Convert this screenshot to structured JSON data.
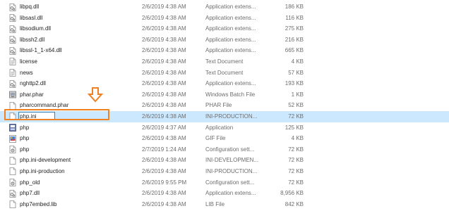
{
  "files": [
    {
      "name": "libpq.dll",
      "date": "2/6/2019 4:38 AM",
      "type": "Application extens...",
      "size": "186 KB",
      "icon": "dll-file-icon"
    },
    {
      "name": "libsasl.dll",
      "date": "2/6/2019 4:38 AM",
      "type": "Application extens...",
      "size": "116 KB",
      "icon": "dll-file-icon"
    },
    {
      "name": "libsodium.dll",
      "date": "2/6/2019 4:38 AM",
      "type": "Application extens...",
      "size": "275 KB",
      "icon": "dll-file-icon"
    },
    {
      "name": "libssh2.dll",
      "date": "2/6/2019 4:38 AM",
      "type": "Application extens...",
      "size": "216 KB",
      "icon": "dll-file-icon"
    },
    {
      "name": "libssl-1_1-x64.dll",
      "date": "2/6/2019 4:38 AM",
      "type": "Application extens...",
      "size": "665 KB",
      "icon": "dll-file-icon"
    },
    {
      "name": "license",
      "date": "2/6/2019 4:38 AM",
      "type": "Text Document",
      "size": "4 KB",
      "icon": "text-file-icon"
    },
    {
      "name": "news",
      "date": "2/6/2019 4:38 AM",
      "type": "Text Document",
      "size": "57 KB",
      "icon": "text-file-icon"
    },
    {
      "name": "nghttp2.dll",
      "date": "2/6/2019 4:38 AM",
      "type": "Application extens...",
      "size": "193 KB",
      "icon": "dll-file-icon"
    },
    {
      "name": "phar.phar",
      "date": "2/6/2019 4:38 AM",
      "type": "Windows Batch File",
      "size": "1 KB",
      "icon": "batch-file-icon"
    },
    {
      "name": "pharcommand.phar",
      "date": "2/6/2019 4:38 AM",
      "type": "PHAR File",
      "size": "52 KB",
      "icon": "blank-file-icon"
    },
    {
      "name": "php.ini",
      "date": "2/6/2019 4:38 AM",
      "type": "INI-PRODUCTION...",
      "size": "72 KB",
      "icon": "blank-file-icon",
      "selected": true,
      "renaming": true
    },
    {
      "name": "php",
      "date": "2/6/2019 4:37 AM",
      "type": "Application",
      "size": "125 KB",
      "icon": "php-exe-icon"
    },
    {
      "name": "php",
      "date": "2/6/2019 4:38 AM",
      "type": "GIF File",
      "size": "4 KB",
      "icon": "image-file-icon"
    },
    {
      "name": "php",
      "date": "2/7/2019 1:24 AM",
      "type": "Configuration sett...",
      "size": "72 KB",
      "icon": "config-file-icon"
    },
    {
      "name": "php.ini-development",
      "date": "2/6/2019 4:38 AM",
      "type": "INI-DEVELOPMEN...",
      "size": "72 KB",
      "icon": "blank-file-icon"
    },
    {
      "name": "php.ini-production",
      "date": "2/6/2019 4:38 AM",
      "type": "INI-PRODUCTION...",
      "size": "72 KB",
      "icon": "blank-file-icon"
    },
    {
      "name": "php_old",
      "date": "2/6/2019 9:55 PM",
      "type": "Configuration sett...",
      "size": "72 KB",
      "icon": "config-file-icon"
    },
    {
      "name": "php7.dll",
      "date": "2/6/2019 4:38 AM",
      "type": "Application extens...",
      "size": "8,956 KB",
      "icon": "dll-file-icon"
    },
    {
      "name": "php7embed.lib",
      "date": "2/6/2019 4:38 AM",
      "type": "LIB File",
      "size": "842 KB",
      "icon": "blank-file-icon"
    }
  ],
  "annotation": {
    "arrow_icon": "down-arrow-icon",
    "highlight_color": "#f08020",
    "selection_color": "#cce8ff"
  }
}
